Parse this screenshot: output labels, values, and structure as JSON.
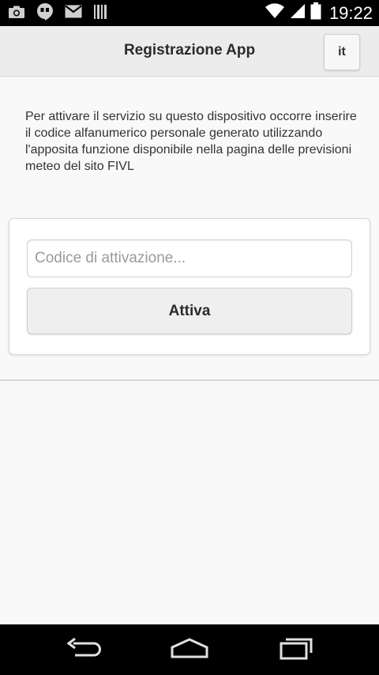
{
  "status_bar": {
    "time": "19:22",
    "left_icons": [
      "camera-icon",
      "hangouts-icon",
      "gmail-icon",
      "barcode-icon"
    ],
    "right_icons": [
      "wifi-icon",
      "signal-icon",
      "battery-icon"
    ]
  },
  "header": {
    "title": "Registrazione App",
    "lang_label": "it"
  },
  "main": {
    "intro_text": "Per attivare il servizio su questo dispositivo occorre inserire il codice alfanumerico personale generato utilizzando l'apposita funzione disponibile nella pagina delle previsioni meteo del sito FIVL",
    "code_field": {
      "value": "",
      "placeholder": "Codice di attivazione..."
    },
    "activate_label": "Attiva"
  },
  "nav_bar": {
    "icons": [
      "back-icon",
      "home-icon",
      "recent-apps-icon"
    ]
  }
}
